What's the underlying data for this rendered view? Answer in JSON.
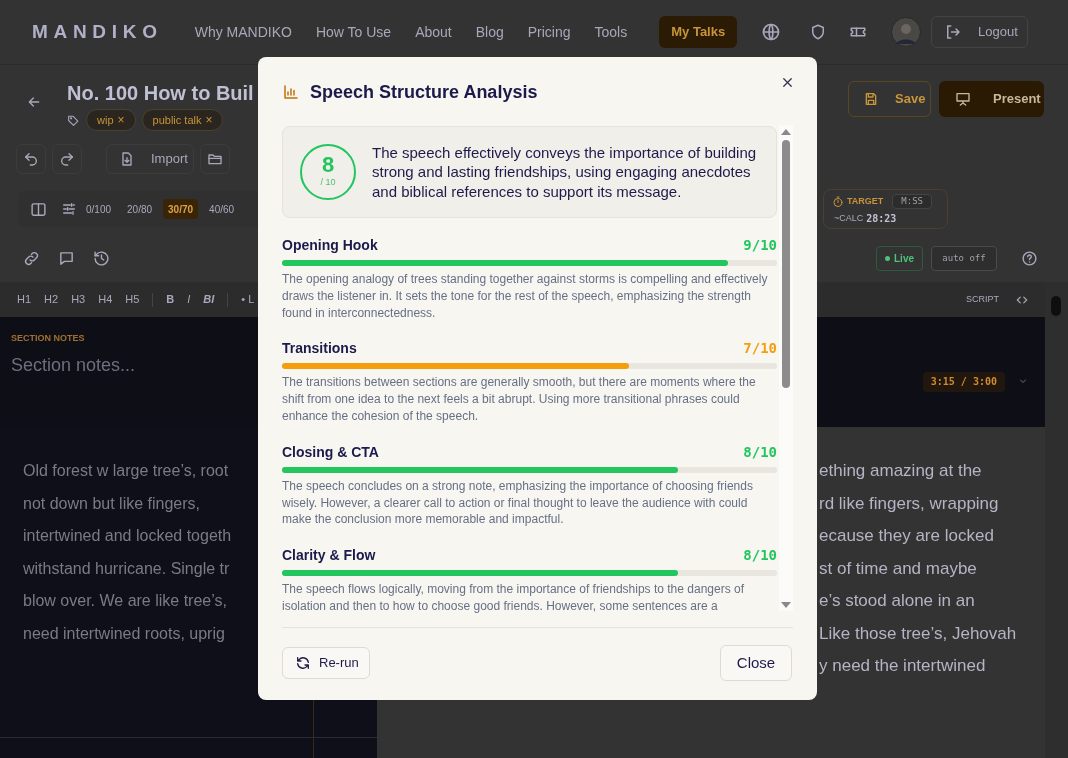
{
  "nav": {
    "logo": "MANDIKO",
    "links": [
      "Why MANDIKO",
      "How To Use",
      "About",
      "Blog",
      "Pricing",
      "Tools"
    ],
    "my_talks": "My Talks",
    "logout": "Logout"
  },
  "header": {
    "title": "No. 100 How to Buil",
    "tags": [
      {
        "label": "wip",
        "remove": "×"
      },
      {
        "label": "public talk",
        "remove": "×"
      }
    ],
    "save": "Save",
    "present": "Present"
  },
  "toolbar": {
    "import": "Import"
  },
  "split": {
    "options": [
      {
        "label": "0/100",
        "selected": false
      },
      {
        "label": "20/80",
        "selected": false
      },
      {
        "label": "30/70",
        "selected": true
      },
      {
        "label": "40/60",
        "selected": false
      }
    ],
    "target_label": "TARGET",
    "target_placeholder": "M:SS",
    "calc_label": "~CALC",
    "calc_value": "28:23"
  },
  "status": {
    "live": "Live",
    "auto": "auto off"
  },
  "format_bar": {
    "buttons": [
      "H1",
      "H2",
      "H3",
      "H4",
      "H5",
      "B",
      "I",
      "BI",
      "• L"
    ],
    "script": "SCRIPT"
  },
  "section_notes": {
    "label": "SECTION NOTES",
    "placeholder": "Section notes...",
    "timer": "3:15 / 3:00"
  },
  "editor": {
    "left_lines": [
      "Old forest w large tree’s, root",
      "not down but like fingers,",
      "intertwined and locked togeth",
      "withstand hurricane. Single tr",
      "blow over. We are like tree’s,",
      "need intertwined roots, uprig"
    ],
    "right_lines": [
      "ething amazing at the",
      "rd like fingers, wrapping",
      "ecause they are locked",
      "st of time and maybe",
      "e’s stood alone in an",
      "Like those tree’s, Jehovah",
      "y need the intertwined"
    ]
  },
  "modal": {
    "title": "Speech Structure Analysis",
    "score": "8",
    "score_max": "/ 10",
    "summary": "The speech effectively conveys the importance of building strong and lasting friendships, using engaging anecdotes and biblical references to support its message.",
    "criteria": [
      {
        "name": "Opening Hook",
        "score": "9/10",
        "level": 0.9,
        "color": "#22c55e",
        "description": "The opening analogy of trees standing together against storms is compelling and effectively draws the listener in. It sets the tone for the rest of the speech, emphasizing the strength found in interconnectedness."
      },
      {
        "name": "Transitions",
        "score": "7/10",
        "level": 0.7,
        "color": "#f59e0b",
        "description": "The transitions between sections are generally smooth, but there are moments where the shift from one idea to the next feels a bit abrupt. Using more transitional phrases could enhance the cohesion of the speech."
      },
      {
        "name": "Closing & CTA",
        "score": "8/10",
        "level": 0.8,
        "color": "#22c55e",
        "description": "The speech concludes on a strong note, emphasizing the importance of choosing friends wisely. However, a clearer call to action or final thought to leave the audience with could make the conclusion more memorable and impactful."
      },
      {
        "name": "Clarity & Flow",
        "score": "8/10",
        "level": 0.8,
        "color": "#22c55e",
        "description": "The speech flows logically, moving from the importance of friendships to the dangers of isolation and then to how to choose good friends. However, some sentences are a"
      }
    ],
    "rerun": "Re-run",
    "close": "Close"
  }
}
